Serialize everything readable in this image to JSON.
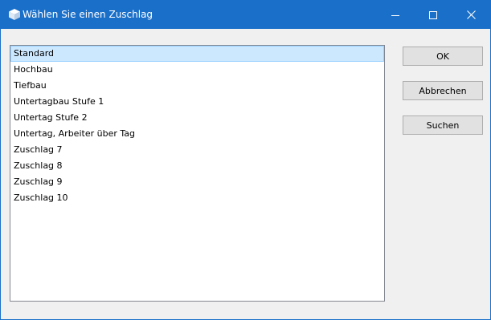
{
  "window": {
    "title": "Wählen Sie einen Zuschlag",
    "accent_color": "#1a6fc9",
    "icons": {
      "app": "cube-icon",
      "minimize": "minimize-icon",
      "maximize": "maximize-icon",
      "close": "close-icon"
    }
  },
  "list": {
    "selected_index": 0,
    "items": [
      "Standard",
      "Hochbau",
      "Tiefbau",
      "Untertagbau Stufe 1",
      "Untertag Stufe 2",
      "Untertag, Arbeiter über Tag",
      "Zuschlag 7",
      "Zuschlag 8",
      "Zuschlag 9",
      "Zuschlag 10"
    ]
  },
  "buttons": {
    "ok": "OK",
    "cancel": "Abbrechen",
    "search": "Suchen"
  }
}
